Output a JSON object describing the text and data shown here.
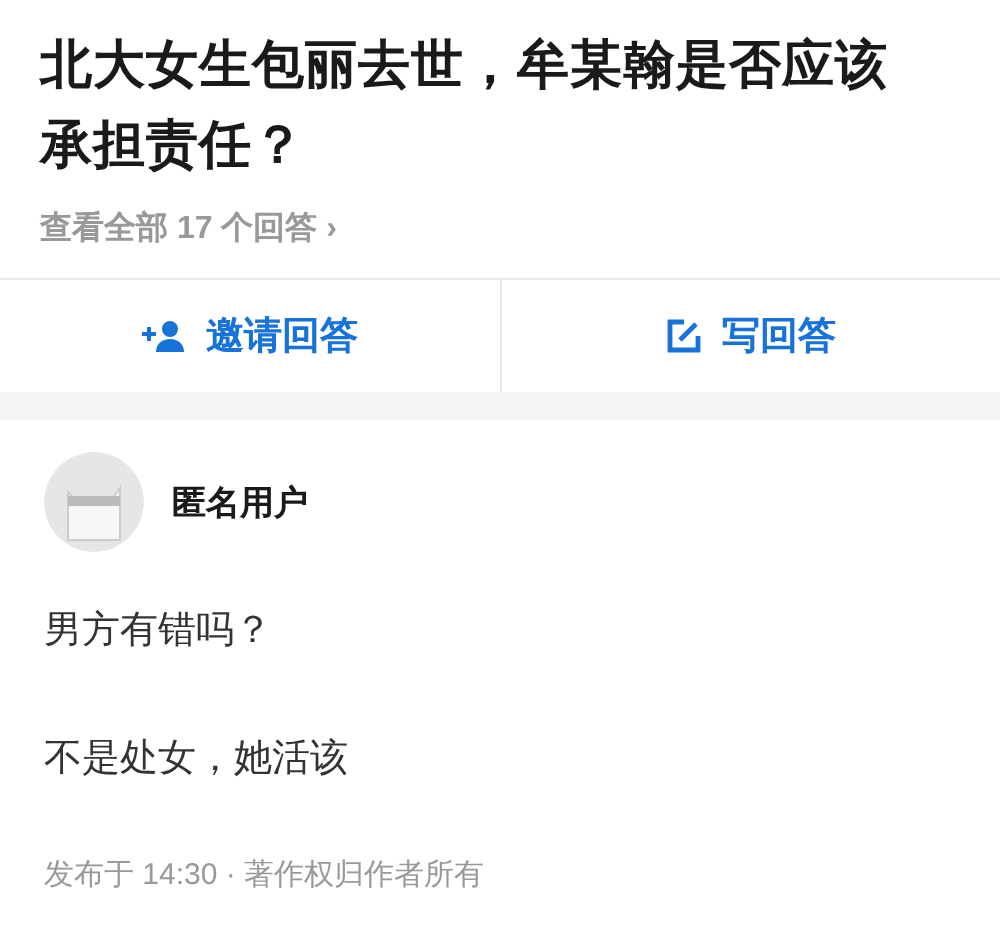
{
  "question": {
    "title": "北大女生包丽去世，牟某翰是否应该承担责任？",
    "view_all": "查看全部 17 个回答 ›"
  },
  "actions": [
    {
      "kind": "invite",
      "label": "邀请回答"
    },
    {
      "kind": "write",
      "label": "写回答"
    }
  ],
  "answer": {
    "author": "匿名用户",
    "paragraphs": [
      "男方有错吗？",
      "不是处女，她活该"
    ],
    "meta": "发布于 14:30 · 著作权归作者所有"
  }
}
